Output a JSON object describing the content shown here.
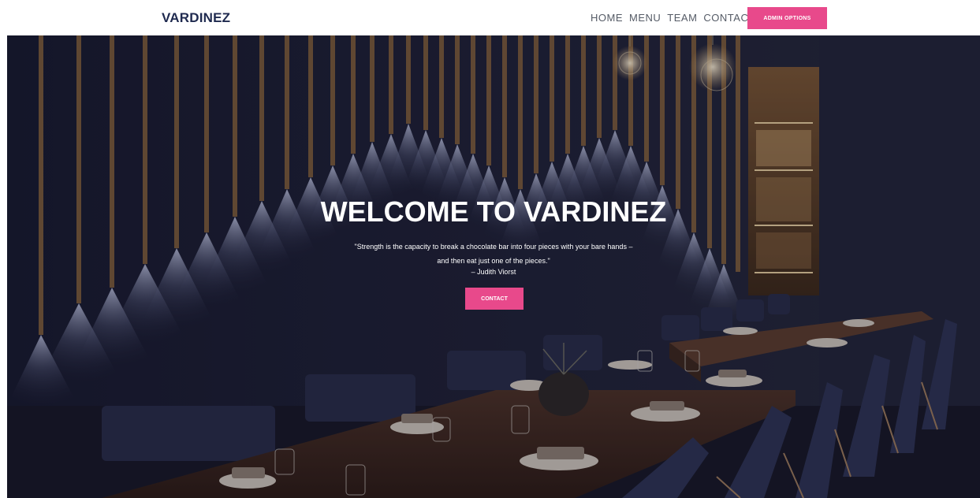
{
  "navbar": {
    "brand": "VARDINEZ",
    "links": [
      "HOME",
      "MENU",
      "TEAM",
      "CONTACT"
    ],
    "admin_button": "ADMIN OPTIONS"
  },
  "hero": {
    "title": "WELCOME TO VARDINEZ",
    "quote": "\"Strength is the capacity to break a chocolate bar into four pieces with your bare hands – and then eat just one of the pieces.\"",
    "author": "– Judith Viorst",
    "contact_button": "CONTACT"
  },
  "colors": {
    "accent": "#e8498b",
    "brand": "#1f2a4f",
    "nav_text": "#555b66",
    "hero_bg": "#1a1c2c"
  }
}
